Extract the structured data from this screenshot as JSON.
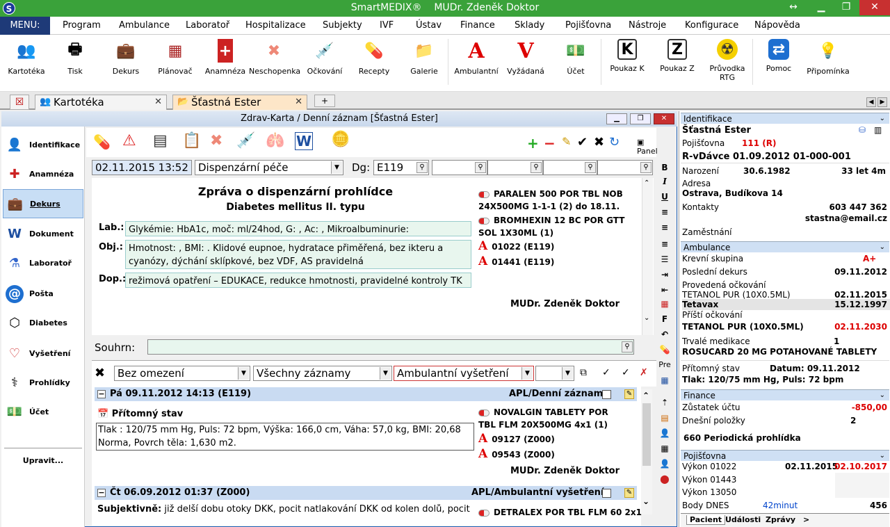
{
  "app": {
    "title": "SmartMEDIX®",
    "doctor": "MUDr. Zdeněk Doktor",
    "logo": "S"
  },
  "menu": {
    "button": "MENU:",
    "items": [
      "Program",
      "Ambulance",
      "Laboratoř",
      "Hospitalizace",
      "Subjekty",
      "IVF",
      "Ústav",
      "Finance",
      "Sklady",
      "Pojišťovna",
      "Nástroje",
      "Konfigurace",
      "Nápověda"
    ]
  },
  "toolbar": [
    {
      "label": "Kartotéka",
      "icon": "people-icon"
    },
    {
      "label": "Tisk",
      "icon": "printer-icon"
    },
    {
      "label": "Dekurs",
      "icon": "medical-bag-icon"
    },
    {
      "label": "Plánovač",
      "icon": "calendar-icon"
    },
    {
      "label": "Anamnéza",
      "icon": "medical-book-icon"
    },
    {
      "label": "Neschopenka",
      "icon": "bandage-icon"
    },
    {
      "label": "Očkování",
      "icon": "syringe-icon"
    },
    {
      "label": "Recepty",
      "icon": "pills-icon"
    },
    {
      "label": "Galerie",
      "icon": "folder-icon"
    },
    {
      "label": "Ambulantní",
      "icon": "letter-a-icon"
    },
    {
      "label": "Vyžádaná",
      "icon": "letter-v-icon"
    },
    {
      "label": "Účet",
      "icon": "money-icon"
    },
    {
      "label": "Poukaz K",
      "icon": "letter-k-icon"
    },
    {
      "label": "Poukaz Z",
      "icon": "letter-z-icon"
    },
    {
      "label": "Průvodka RTG",
      "icon": "radiation-icon"
    },
    {
      "label": "Pomoc",
      "icon": "remote-help-icon"
    },
    {
      "label": "Připomínka",
      "icon": "lightbulb-icon"
    }
  ],
  "tabs": {
    "t1": "Kartotéka",
    "t2": "Šťastná  Ester"
  },
  "nav": [
    "Identifikace",
    "Anamnéza",
    "Dekurs",
    "Dokument",
    "Laboratoř",
    "Pošta",
    "Diabetes",
    "Vyšetření",
    "Prohlídky",
    "Účet"
  ],
  "nav_edit": "Upravit...",
  "doc": {
    "title": "Zdrav-Karta / Denní záznam [Šťastná  Ester]",
    "panel": "Panel",
    "datetime": "02.11.2015 13:52",
    "type": "Dispenzární péče",
    "dg_label": "Dg:",
    "dg": "E119",
    "report_title": "Zpráva o dispenzární prohlídce",
    "report_sub": "Diabetes mellitus II. typu",
    "lab_label": "Lab.:",
    "lab": "Glykémie: HbA1c, moč: ml/24hod, G: , Ac: , Mikroalbuminurie:",
    "obj_label": "Obj.:",
    "obj": "Hmotnost: , BMI: . Klidové eupnoe, hydratace přiměřená, bez ikteru a cyanózy, dýchání sklípkové, bez VDF, AS pravidelná",
    "dop_label": "Dop.:",
    "dop": "režimová opatření – EDUKACE, redukce hmotnosti, pravidelné kontroly TK",
    "rx1": "PARALEN 500 POR TBL NOB 24X500MG 1-1-1 (2) do 18.11.",
    "rx2": "BROMHEXIN 12 BC POR GTT SOL 1X30ML (1)",
    "a1": "01022 (E119)",
    "a2": "01441 (E119)",
    "signature": "MUDr. Zdeněk Doktor",
    "souhrn_label": "Souhrn:"
  },
  "filter": {
    "f1": "Bez omezení",
    "f2": "Všechny záznamy",
    "f3": "Ambulantní vyšetření"
  },
  "rec1": {
    "header": "Pá 09.11.2012 14:13 (E119)",
    "type": "APL/Denní záznam",
    "section": "Přítomný stav",
    "text": "Tlak : 120/75 mm Hg, Puls: 72 bpm, Výška: 166,0 cm, Váha: 57,0 kg, BMI: 20,68 Norma, Povrch těla: 1,630 m2.",
    "rx": "NOVALGIN TABLETY POR TBL FLM 20X500MG 4x1 (1)",
    "a1": "09127 (Z000)",
    "a2": "09543 (Z000)",
    "signature": "MUDr. Zdeněk Doktor"
  },
  "rec2": {
    "header": "Čt 06.09.2012 01:37 (Z000)",
    "type": "APL/Ambulantní vyšetření",
    "subj_label": "Subjektivně:",
    "subj": "již delší dobu otoky DKK, pocit natlakování DKK od kolen dolů, pocit",
    "rx": "DETRALEX POR TBL FLM 60 2x1"
  },
  "right": {
    "identifikace": "Identifikace",
    "name": "Šťastná  Ester",
    "poj_label": "Pojišťovna",
    "poj": "111 (R)",
    "rvd": "R-vDávce 01.09.2012 01-000-001",
    "nar_label": "Narození",
    "nar": "30.6.1982",
    "age": "33 let 4m",
    "adresa_label": "Adresa",
    "adresa": "Ostrava, Budíkova 14",
    "kontakty_label": "Kontakty",
    "phone": "603 447 362",
    "email": "stastna@email.cz",
    "zam_label": "Zaměstnání",
    "ambulance": "Ambulance",
    "ks_label": "Krevní skupina",
    "ks": "A+",
    "pd_label": "Poslední dekurs",
    "pd": "09.11.2012",
    "po_label": "Provedená očkování",
    "po1": "TETANOL PUR (10X0.5ML)",
    "po1d": "02.11.2015",
    "po2": "Tetavax",
    "po2d": "15.12.1997",
    "pri_label": "Příští očkování",
    "pri": "TETANOL PUR (10X0.5ML)",
    "prid": "02.11.2030",
    "tm_label": "Trvalé medikace",
    "tm_count": "1",
    "tm": "ROSUCARD 20 MG POTAHOVANÉ TABLETY",
    "ps_label": "Přítomný stav",
    "ps_date": "Datum: 09.11.2012",
    "ps": "Tlak: 120/75 mm Hg, Puls: 72 bpm",
    "finance": "Finance",
    "zu_label": "Zůstatek účtu",
    "zu": "-850,00",
    "dp_label": "Dnešní položky",
    "dp": "2",
    "perio": "660 Periodická prohlídka",
    "pojistovna": "Pojišťovna",
    "v1_label": "Výkon 01022",
    "v1a": "02.11.2015",
    "v1b": "02.10.2017",
    "v2_label": "Výkon 01443",
    "v3_label": "Výkon 13050",
    "bd_label": "Body DNES",
    "bd_min": "42minut",
    "bd": "456",
    "tabs": [
      "Pacient",
      "Události",
      "Zprávy",
      ">"
    ]
  }
}
